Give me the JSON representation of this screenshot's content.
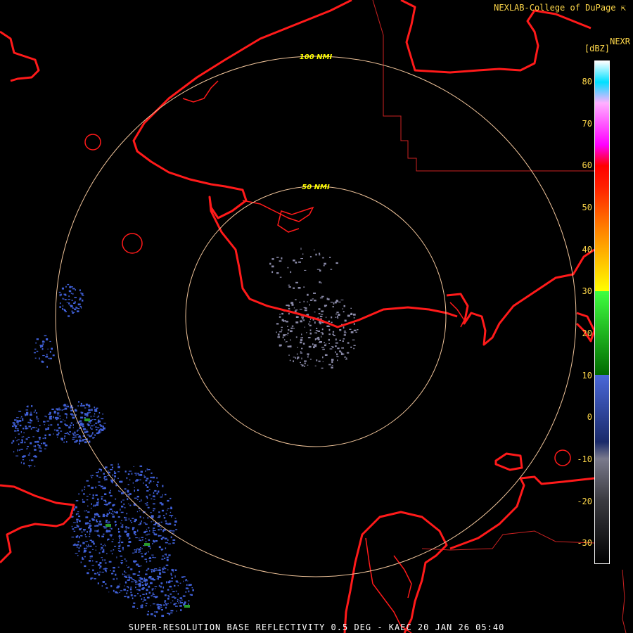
{
  "credit": "NEXLAB-College of DuPage",
  "credit_icon": "corner-arrow-icon",
  "product": "NEXR",
  "unit": "[dBZ]",
  "footer": "SUPER-RESOLUTION BASE REFLECTIVITY 0.5 DEG - KAEC 20 JAN 26 05:40",
  "rings": [
    {
      "label": "100 NMI",
      "range_nmi": 100
    },
    {
      "label": "50 NMI",
      "range_nmi": 50
    }
  ],
  "colors": {
    "background": "#000000",
    "coastline": "#ff1a1a",
    "border": "#cc2222",
    "range_ring": "#f0c49a",
    "ring_label": "#ffff00",
    "legend_text": "#ffd84a",
    "footer_text": "#ffffff",
    "echo_light": "#4060d8",
    "echo_mid": "#2a9a2a",
    "echo_noise": "#8a8aa8"
  },
  "legend": {
    "min": -35,
    "max": 85,
    "ticks": [
      "80",
      "70",
      "60",
      "50",
      "40",
      "30",
      "20",
      "10",
      "0",
      "-10",
      "-20",
      "-30"
    ],
    "stops": [
      {
        "dbz": -35,
        "color": "#000000"
      },
      {
        "dbz": -20,
        "color": "#3a3a40"
      },
      {
        "dbz": -10,
        "color": "#7a7a8c"
      },
      {
        "dbz": -6,
        "color": "#1a2a6a"
      },
      {
        "dbz": 10,
        "color": "#4a68d8"
      },
      {
        "dbz": 10,
        "color": "#006a00"
      },
      {
        "dbz": 30,
        "color": "#40ff40"
      },
      {
        "dbz": 30,
        "color": "#ffff00"
      },
      {
        "dbz": 45,
        "color": "#ff8000"
      },
      {
        "dbz": 55,
        "color": "#ff2000"
      },
      {
        "dbz": 60,
        "color": "#ff0000"
      },
      {
        "dbz": 65,
        "color": "#ff00ff"
      },
      {
        "dbz": 75,
        "color": "#ffb0ff"
      },
      {
        "dbz": 80,
        "color": "#00e0ff"
      },
      {
        "dbz": 85,
        "color": "#ffffff"
      }
    ]
  }
}
